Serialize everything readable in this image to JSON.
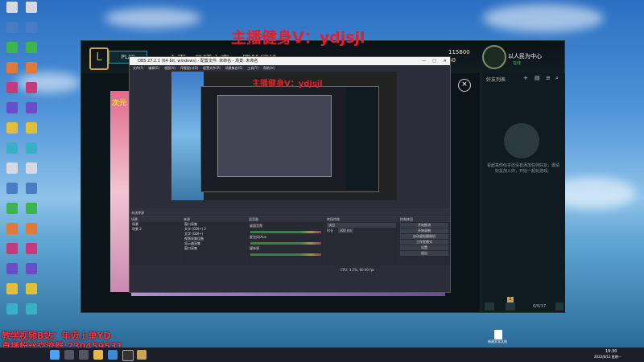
{
  "watermark": {
    "top_banner": "主播健身V：ydjsjl",
    "preview_banner": "主播健身V：ydjsjl",
    "bottom_line_1": "教学视频B站：年迈上单YD",
    "bottom_line_2": "直播粉丝交流群:230459531"
  },
  "client": {
    "play_label": "PLAY",
    "nav": [
      "主页",
      "云顶之弈",
      "冒险征途"
    ],
    "currency_1": "115800",
    "currency_2": "50",
    "profile_name": "以人民为中心",
    "profile_status": "在线",
    "friends_header": "好友列表",
    "empty_friends_text": "看起来你似乎还没有添加任何好友，邀请好友加入你，开始一起玩游戏。",
    "banner_text": "次元",
    "bottom_counter": "0/5/17",
    "notification_count": "1"
  },
  "obs": {
    "title": "OBS 27.2.1 (64-bit, windows) - 配置文件: 未命名 - 场景: 未命名",
    "menu": [
      "文件(F)",
      "编辑(E)",
      "视图(V)",
      "停靠窗口(D)",
      "配置文件(P)",
      "场景集合(S)",
      "工具(T)",
      "帮助(H)"
    ],
    "source_bar": "未选择源",
    "docks": {
      "scenes": "场景",
      "sources": "来源",
      "mixer": "混音器",
      "transitions": "转场特效",
      "controls": "控制按钮"
    },
    "scenes": [
      "场景",
      "场景 2"
    ],
    "sources": [
      "窗口采集",
      "文字 (GDI+) 2",
      "文字 (GDI+)",
      "视频采集设备",
      "显示器采集",
      "窗口采集"
    ],
    "mixer_channels": [
      "桌面音频",
      "麦克风/Aux",
      "媒体源"
    ],
    "transition_value": "淡出",
    "duration_label": "时长",
    "duration_value": "300 ms",
    "controls": [
      "开始推流",
      "开始录制",
      "启动虚拟摄像机",
      "工作室模式",
      "设置",
      "退出"
    ],
    "status": "CPU: 3.2%, 60.00 fps"
  },
  "taskbar": {
    "time": "19:30",
    "date": "2022/8/12 星期一"
  },
  "desktop": {
    "file_label": "新建文本文档"
  }
}
